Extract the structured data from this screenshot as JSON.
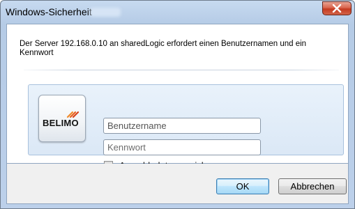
{
  "window": {
    "title": "Windows-Sicherheit"
  },
  "dialog": {
    "message": "Der Server 192.168.0.10 an sharedLogic erfordert einen Benutzernamen und ein Kennwort"
  },
  "logo": {
    "text": "BELIMO",
    "icon": "belimo-logo-icon"
  },
  "credentials": {
    "username_placeholder": "Benutzername",
    "username_value": "",
    "password_placeholder": "Kennwort",
    "password_value": "",
    "remember_label": "Anmeldedaten speichern",
    "remember_checked": false
  },
  "buttons": {
    "ok_label": "OK",
    "cancel_label": "Abbrechen"
  },
  "colors": {
    "title_bar": "#bcd0ea",
    "close_button": "#c4391f",
    "panel_background": "#e9f2fb",
    "footer_background": "#f0f0f0",
    "ok_button_border": "#3c7fb1"
  }
}
